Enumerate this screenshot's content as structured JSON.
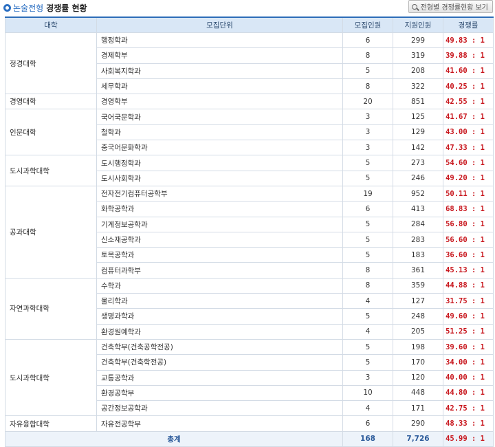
{
  "header": {
    "title_part1": "논술전형",
    "title_part2": "경쟁률 현황",
    "view_button_label": "전형별 경쟁률현황 보기"
  },
  "table": {
    "columns": [
      "대학",
      "모집단위",
      "모집인원",
      "지원인원",
      "경쟁률"
    ],
    "groups": [
      {
        "college": "정경대학",
        "rows": [
          {
            "unit": "행정학과",
            "quota": "6",
            "applicants": "299",
            "rate": "49.83 : 1"
          },
          {
            "unit": "경제학부",
            "quota": "8",
            "applicants": "319",
            "rate": "39.88 : 1"
          },
          {
            "unit": "사회복지학과",
            "quota": "5",
            "applicants": "208",
            "rate": "41.60 : 1"
          },
          {
            "unit": "세무학과",
            "quota": "8",
            "applicants": "322",
            "rate": "40.25 : 1"
          }
        ]
      },
      {
        "college": "경영대학",
        "rows": [
          {
            "unit": "경영학부",
            "quota": "20",
            "applicants": "851",
            "rate": "42.55 : 1"
          }
        ]
      },
      {
        "college": "인문대학",
        "rows": [
          {
            "unit": "국어국문학과",
            "quota": "3",
            "applicants": "125",
            "rate": "41.67 : 1"
          },
          {
            "unit": "철학과",
            "quota": "3",
            "applicants": "129",
            "rate": "43.00 : 1"
          },
          {
            "unit": "중국어문화학과",
            "quota": "3",
            "applicants": "142",
            "rate": "47.33 : 1"
          }
        ]
      },
      {
        "college": "도시과학대학",
        "rows": [
          {
            "unit": "도시행정학과",
            "quota": "5",
            "applicants": "273",
            "rate": "54.60 : 1"
          },
          {
            "unit": "도시사회학과",
            "quota": "5",
            "applicants": "246",
            "rate": "49.20 : 1"
          }
        ]
      },
      {
        "college": "공과대학",
        "rows": [
          {
            "unit": "전자전기컴퓨터공학부",
            "quota": "19",
            "applicants": "952",
            "rate": "50.11 : 1"
          },
          {
            "unit": "화학공학과",
            "quota": "6",
            "applicants": "413",
            "rate": "68.83 : 1"
          },
          {
            "unit": "기계정보공학과",
            "quota": "5",
            "applicants": "284",
            "rate": "56.80 : 1"
          },
          {
            "unit": "신소재공학과",
            "quota": "5",
            "applicants": "283",
            "rate": "56.60 : 1"
          },
          {
            "unit": "토목공학과",
            "quota": "5",
            "applicants": "183",
            "rate": "36.60 : 1"
          },
          {
            "unit": "컴퓨터과학부",
            "quota": "8",
            "applicants": "361",
            "rate": "45.13 : 1"
          }
        ]
      },
      {
        "college": "자연과학대학",
        "rows": [
          {
            "unit": "수학과",
            "quota": "8",
            "applicants": "359",
            "rate": "44.88 : 1"
          },
          {
            "unit": "물리학과",
            "quota": "4",
            "applicants": "127",
            "rate": "31.75 : 1"
          },
          {
            "unit": "생명과학과",
            "quota": "5",
            "applicants": "248",
            "rate": "49.60 : 1"
          },
          {
            "unit": "환경원예학과",
            "quota": "4",
            "applicants": "205",
            "rate": "51.25 : 1"
          }
        ]
      },
      {
        "college": "도시과학대학",
        "rows": [
          {
            "unit": "건축학부(건축공학전공)",
            "quota": "5",
            "applicants": "198",
            "rate": "39.60 : 1"
          },
          {
            "unit": "건축학부(건축학전공)",
            "quota": "5",
            "applicants": "170",
            "rate": "34.00 : 1"
          },
          {
            "unit": "교통공학과",
            "quota": "3",
            "applicants": "120",
            "rate": "40.00 : 1"
          },
          {
            "unit": "환경공학부",
            "quota": "10",
            "applicants": "448",
            "rate": "44.80 : 1"
          },
          {
            "unit": "공간정보공학과",
            "quota": "4",
            "applicants": "171",
            "rate": "42.75 : 1"
          }
        ]
      },
      {
        "college": "자유융합대학",
        "rows": [
          {
            "unit": "자유전공학부",
            "quota": "6",
            "applicants": "290",
            "rate": "48.33 : 1"
          }
        ]
      }
    ],
    "total": {
      "label": "총계",
      "quota": "168",
      "applicants": "7,726",
      "rate": "45.99 : 1"
    }
  },
  "colors": {
    "rate_text": "#c8161d",
    "header_bg": "#d9e7f6",
    "header_border": "#2c6cb8",
    "accent": "#2b6fc2"
  }
}
